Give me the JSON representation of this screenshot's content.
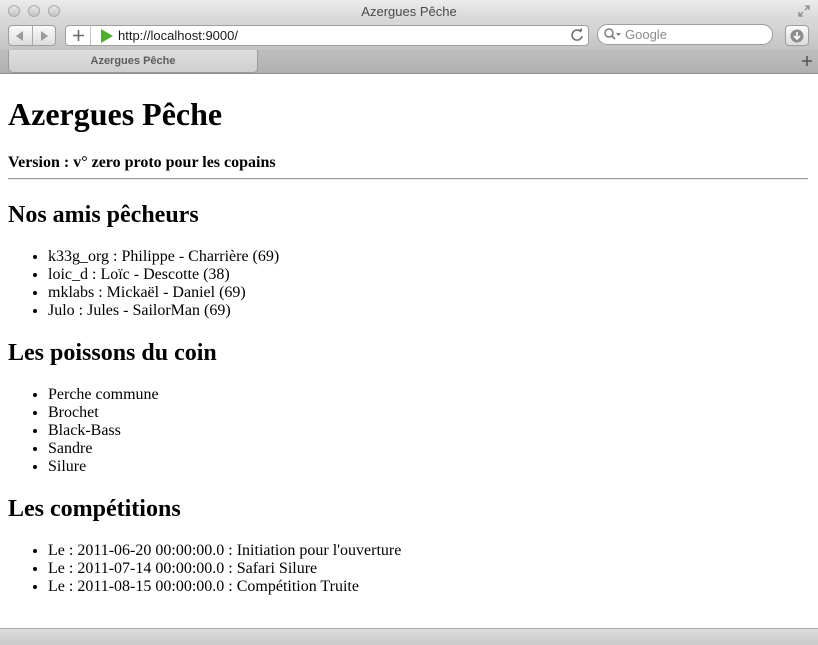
{
  "window": {
    "title": "Azergues Pêche"
  },
  "toolbar": {
    "url": "http://localhost:9000/",
    "search_placeholder": "Google"
  },
  "tabs": [
    {
      "label": "Azergues Pêche"
    }
  ],
  "page": {
    "heading": "Azergues Pêche",
    "version": "Version : v° zero proto pour les copains",
    "friends_heading": "Nos amis pêcheurs",
    "friends": [
      "k33g_org : Philippe - Charrière (69)",
      "loic_d : Loïc - Descotte (38)",
      "mklabs : Mickaël - Daniel (69)",
      "Julo : Jules - SailorMan (69)"
    ],
    "fish_heading": "Les poissons du coin",
    "fish": [
      "Perche commune",
      "Brochet",
      "Black-Bass",
      "Sandre",
      "Silure"
    ],
    "competitions_heading": "Les compétitions",
    "competitions": [
      "Le : 2011-06-20 00:00:00.0 : Initiation pour l'ouverture",
      "Le : 2011-07-14 00:00:00.0 : Safari Silure",
      "Le : 2011-08-15 00:00:00.0 : Compétition Truite"
    ]
  },
  "colors": {
    "play_icon": "#4caf2f"
  }
}
